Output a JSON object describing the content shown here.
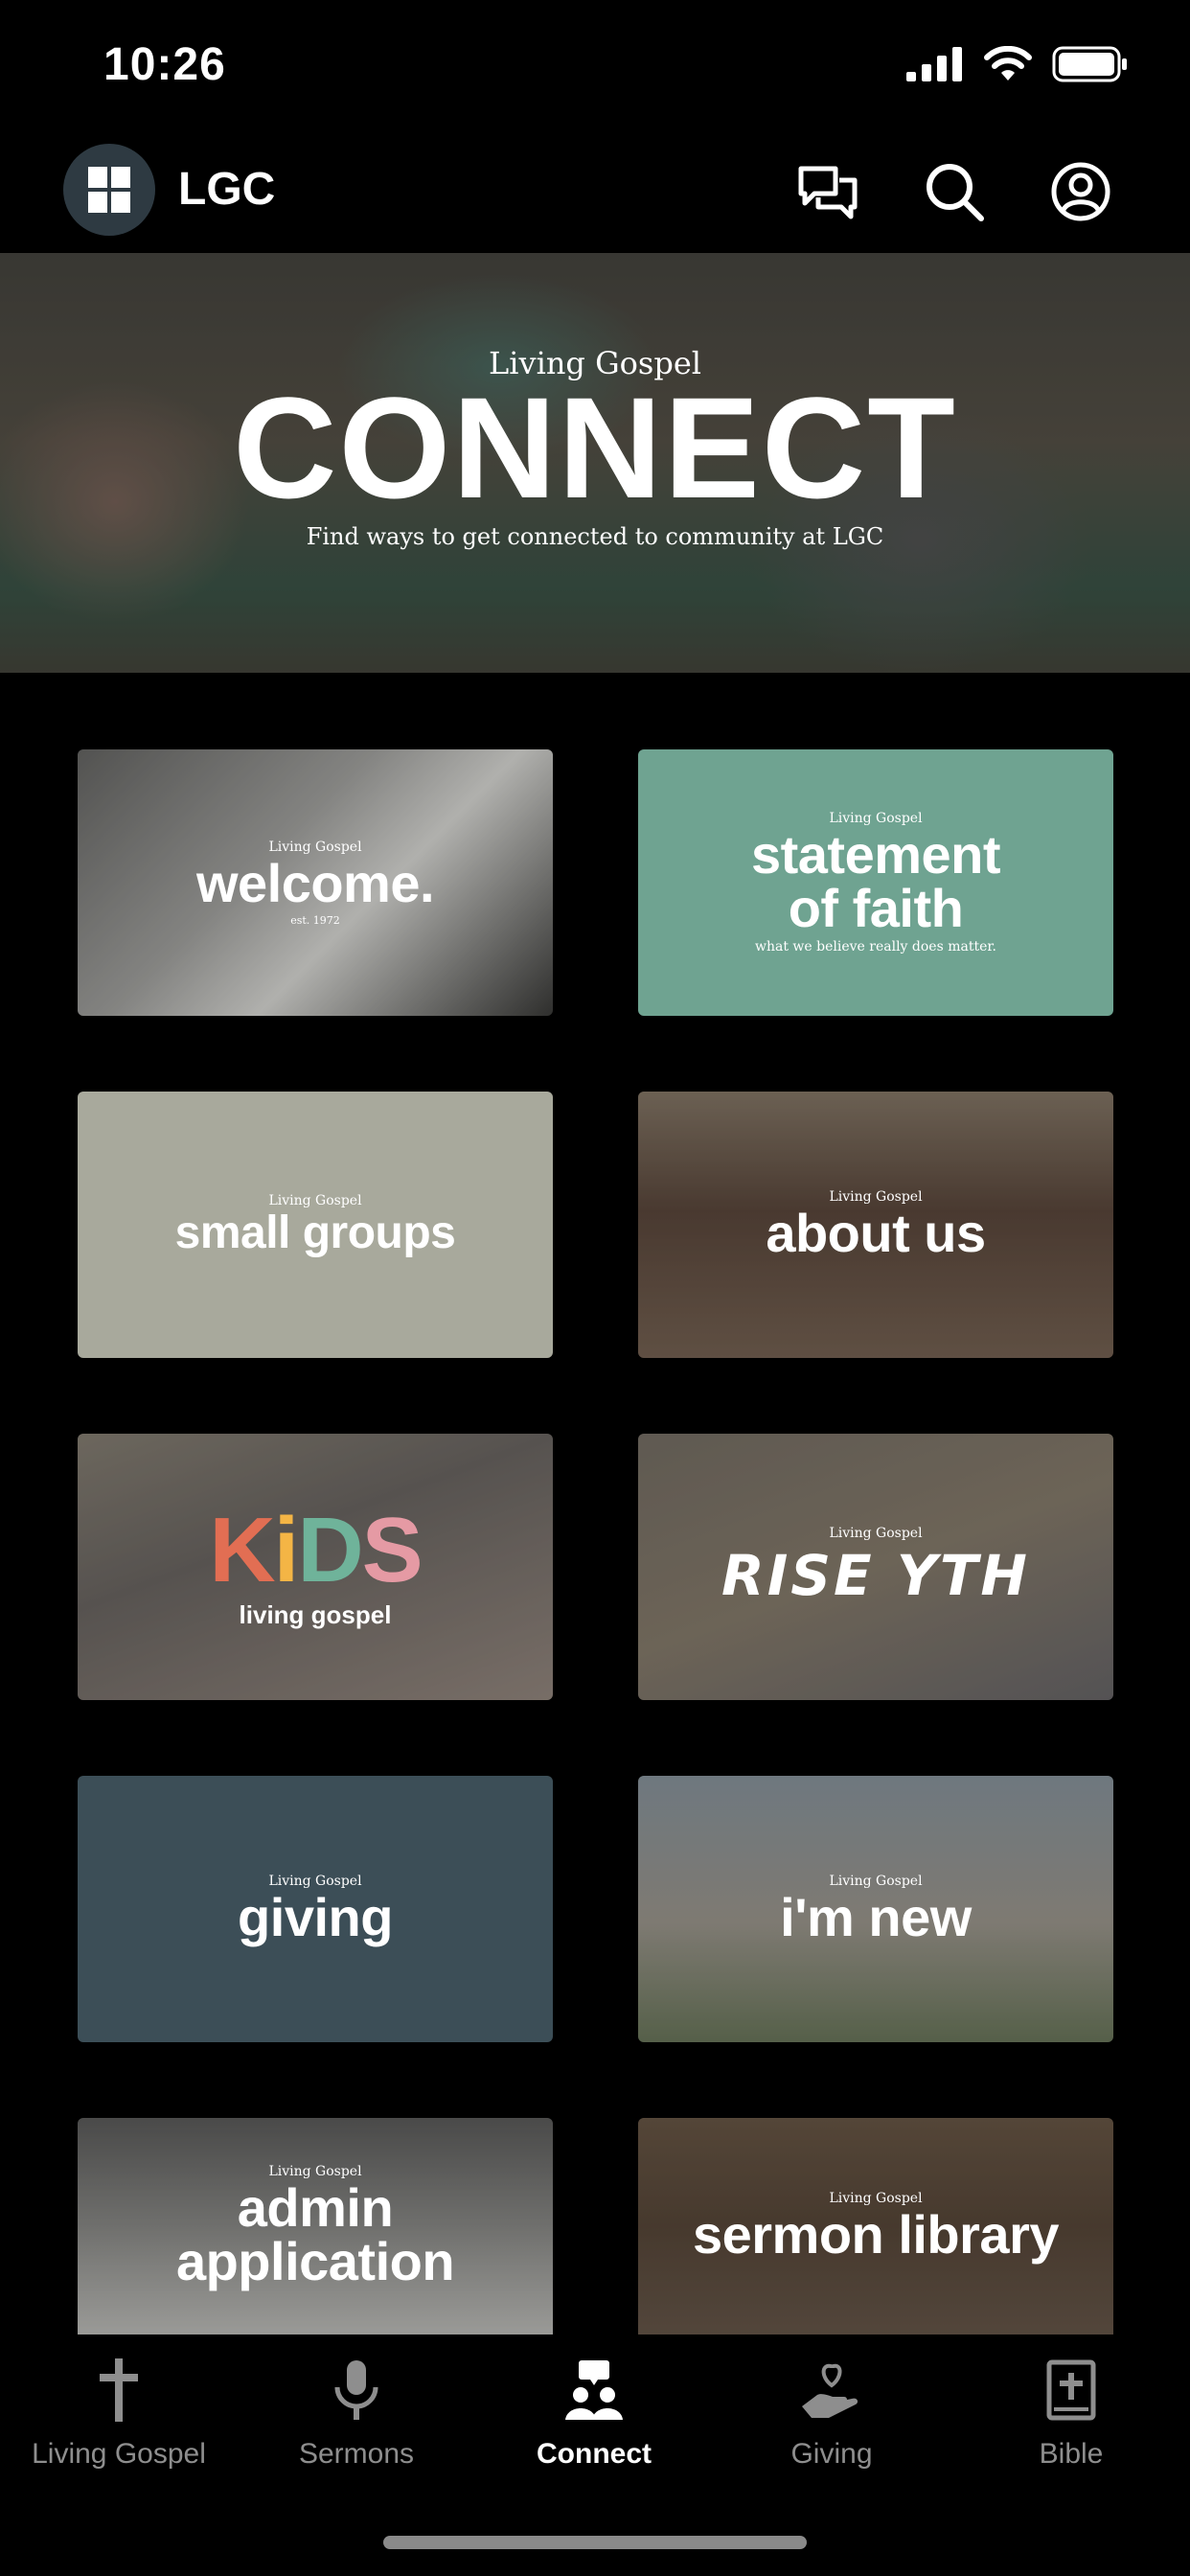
{
  "status_bar": {
    "time": "10:26"
  },
  "header": {
    "title": "LGC"
  },
  "hero": {
    "eyebrow": "Living Gospel",
    "title": "CONNECT",
    "subtitle": "Find ways to get connected to community at LGC"
  },
  "tiles": [
    {
      "eyebrow": "Living Gospel",
      "label": "welcome.",
      "sub": "est. 1972"
    },
    {
      "eyebrow": "Living Gospel",
      "label_line1": "statement",
      "label_line2": "of faith",
      "sub": "what we believe really does matter."
    },
    {
      "eyebrow": "Living Gospel",
      "label": "small groups"
    },
    {
      "eyebrow": "Living Gospel",
      "label": "about us"
    },
    {
      "label_letters": [
        "K",
        "i",
        "D",
        "S"
      ],
      "sub": "living gospel"
    },
    {
      "eyebrow": "Living Gospel",
      "label": "RISE YTH"
    },
    {
      "eyebrow": "Living Gospel",
      "label": "giving"
    },
    {
      "eyebrow": "Living Gospel",
      "label": "i'm new"
    },
    {
      "eyebrow": "Living Gospel",
      "label_line1": "admin",
      "label_line2": "application"
    },
    {
      "eyebrow": "Living Gospel",
      "label": "sermon library"
    }
  ],
  "tabs": [
    {
      "label": "Living Gospel",
      "icon": "cross-icon",
      "active": false
    },
    {
      "label": "Sermons",
      "icon": "microphone-icon",
      "active": false
    },
    {
      "label": "Connect",
      "icon": "people-icon",
      "active": true
    },
    {
      "label": "Giving",
      "icon": "heart-hand-icon",
      "active": false
    },
    {
      "label": "Bible",
      "icon": "bible-icon",
      "active": false
    }
  ],
  "colors": {
    "background": "#000000",
    "tab_inactive": "#8e8e8e",
    "tab_active": "#ffffff",
    "faith_tile": "#6fa391",
    "giving_tile": "#3c4e57"
  }
}
